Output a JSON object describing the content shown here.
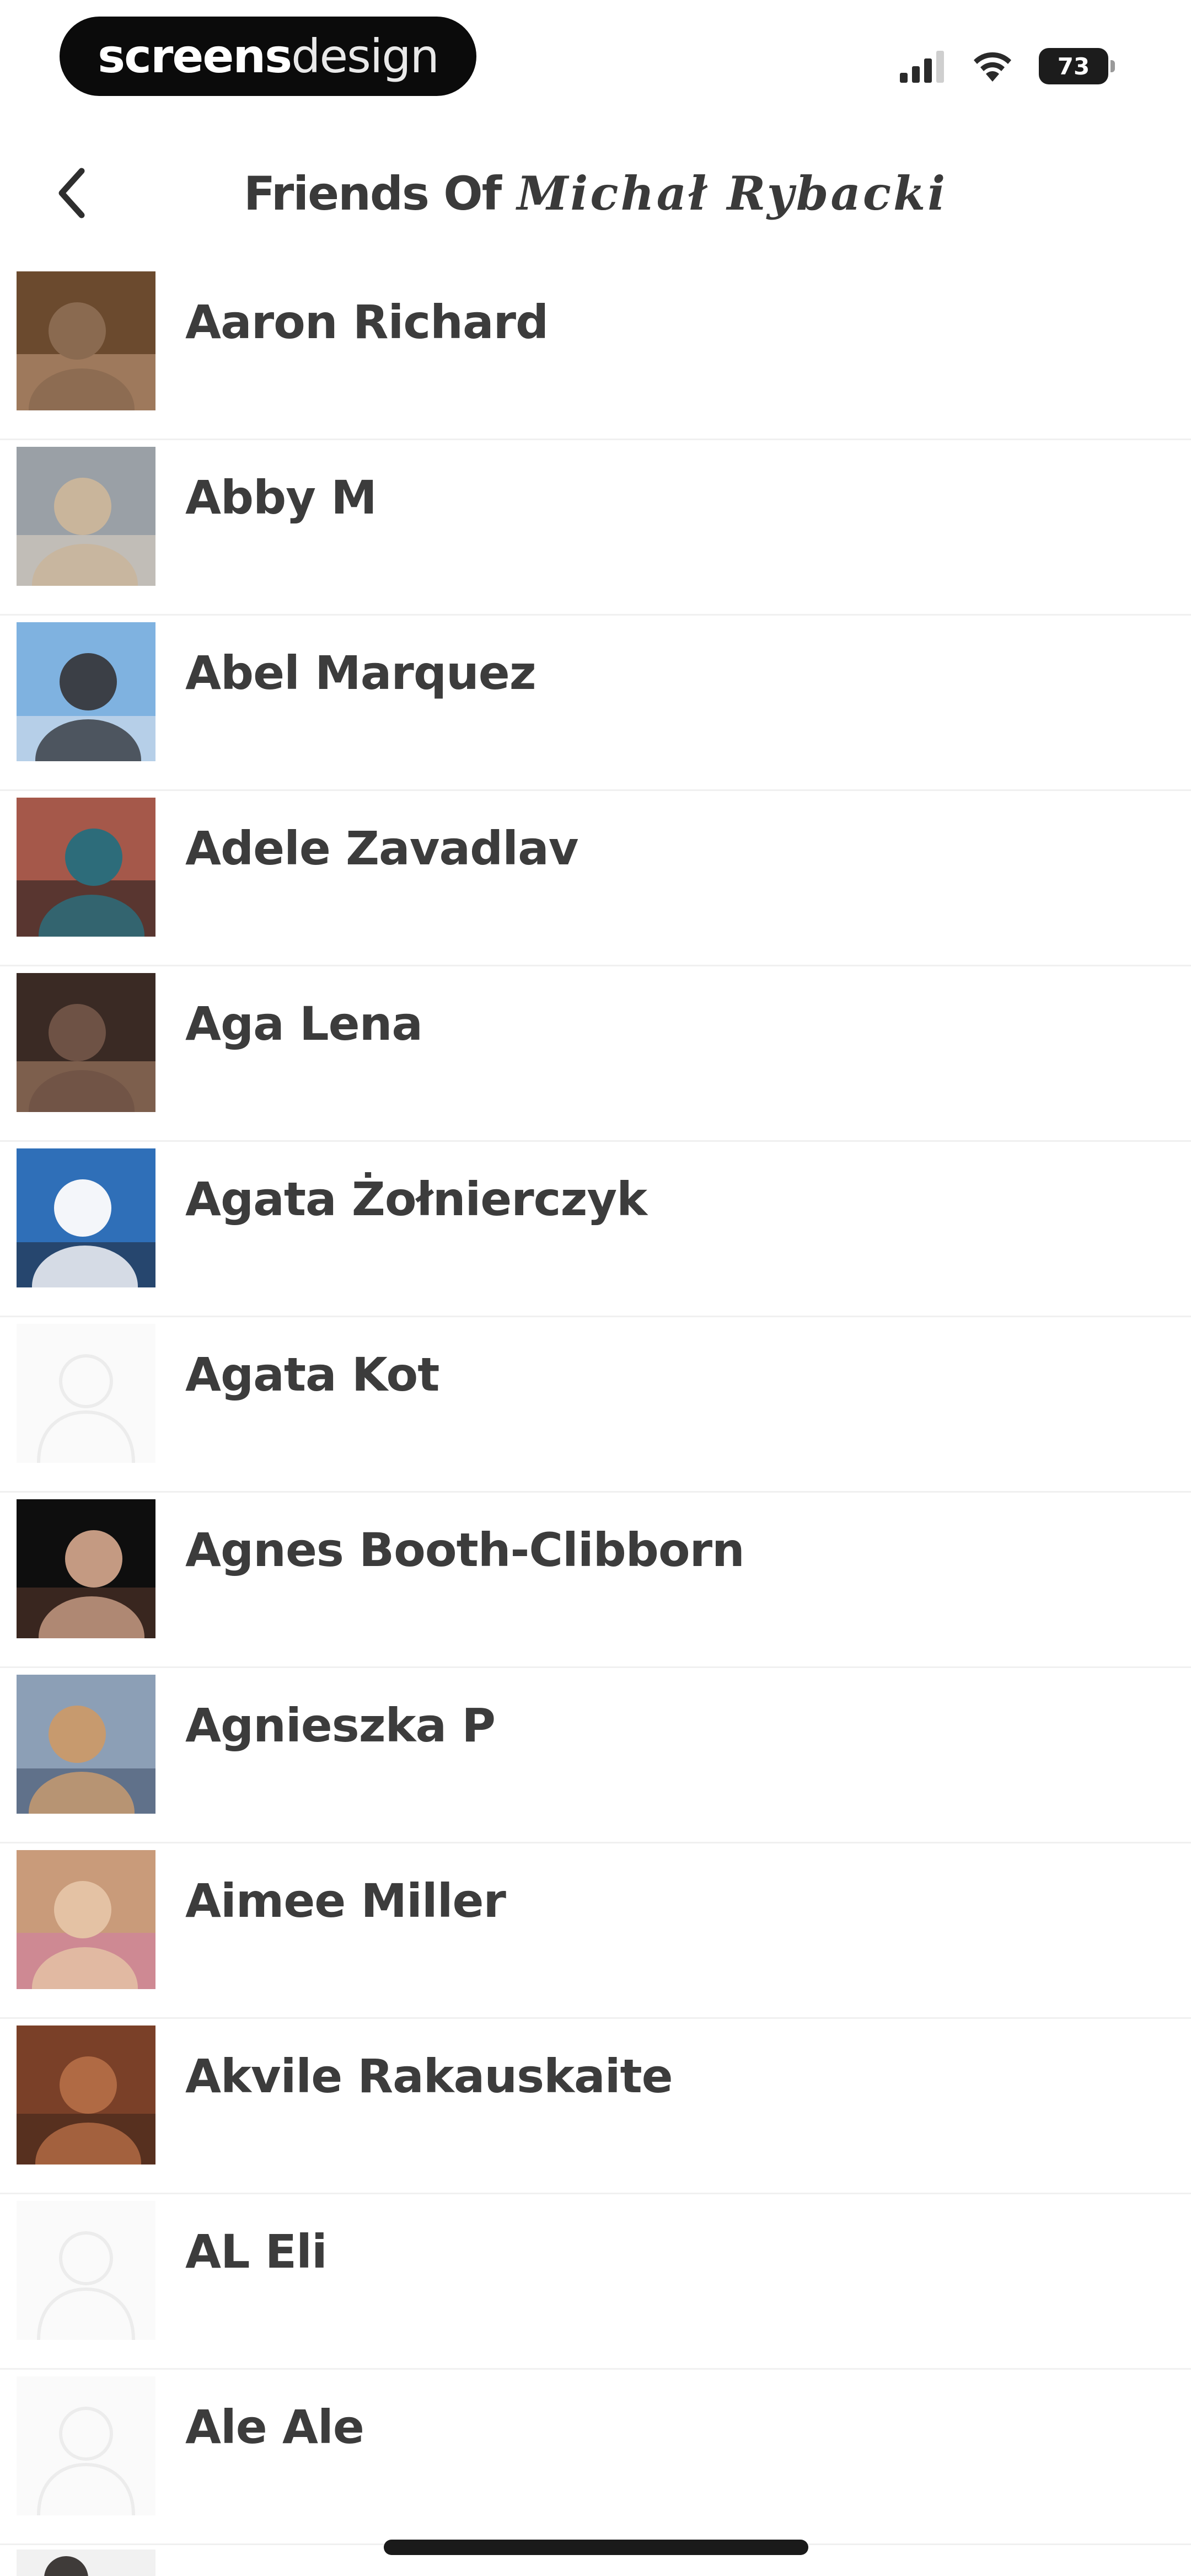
{
  "status_bar": {
    "brand_bold": "screens",
    "brand_light": "design",
    "battery_level": "73",
    "icons": [
      "signal-icon",
      "wifi-icon",
      "battery-icon"
    ]
  },
  "header": {
    "back_icon": "chevron-left-icon",
    "title_prefix": "Friends Of",
    "title_name": "Michał Rybacki"
  },
  "friends": [
    {
      "name": "Aaron Richard",
      "avatar": "photo",
      "colors": [
        "#6b4a2e",
        "#8a6a50",
        "#c9a184"
      ]
    },
    {
      "name": "Abby M",
      "avatar": "photo",
      "colors": [
        "#9aa0a6",
        "#c9b59b",
        "#e2d6c4"
      ]
    },
    {
      "name": "Abel Marquez",
      "avatar": "photo",
      "colors": [
        "#7fb2e0",
        "#3b3f46",
        "#e3e8ee"
      ]
    },
    {
      "name": "Adele Zavadlav",
      "avatar": "photo",
      "colors": [
        "#a5584a",
        "#2d6c7a",
        "#1b1b1b"
      ]
    },
    {
      "name": "Aga Lena",
      "avatar": "photo",
      "colors": [
        "#3a2a24",
        "#6e5245",
        "#b48a70"
      ]
    },
    {
      "name": "Agata Żołnierczyk",
      "avatar": "photo",
      "colors": [
        "#2f6fb8",
        "#f4f6fa",
        "#1f2432"
      ]
    },
    {
      "name": "Agata Kot",
      "avatar": "placeholder",
      "colors": [
        "#fbfbfb",
        "#f3f3f3",
        "#f3f3f3"
      ]
    },
    {
      "name": "Agnes Booth-Clibborn",
      "avatar": "photo",
      "colors": [
        "#0e0e0e",
        "#c49a82",
        "#5d3b2e"
      ]
    },
    {
      "name": "Agnieszka P",
      "avatar": "photo",
      "colors": [
        "#8c9fb6",
        "#c79a6e",
        "#3c4b66"
      ]
    },
    {
      "name": "Aimee Miller",
      "avatar": "photo",
      "colors": [
        "#c99b7a",
        "#e4c2a4",
        "#d27aa8"
      ]
    },
    {
      "name": "Akvile Rakauskaite",
      "avatar": "photo",
      "colors": [
        "#7a4028",
        "#b06a44",
        "#3a2218"
      ]
    },
    {
      "name": "AL Eli",
      "avatar": "placeholder",
      "colors": [
        "#fbfbfb",
        "#f3f3f3",
        "#f3f3f3"
      ]
    },
    {
      "name": "Ale Ale",
      "avatar": "placeholder",
      "colors": [
        "#fbfbfb",
        "#f3f3f3",
        "#f3f3f3"
      ]
    }
  ]
}
